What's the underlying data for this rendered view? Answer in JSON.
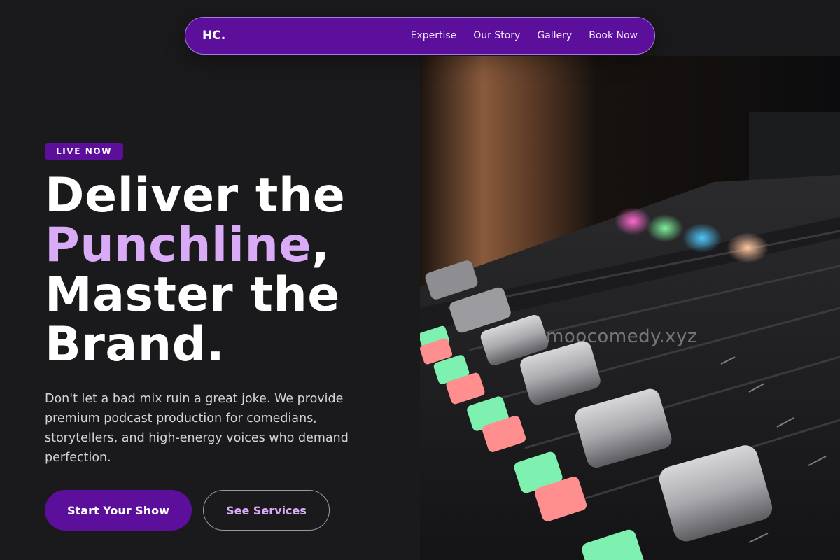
{
  "nav": {
    "logo": "HC.",
    "links": [
      {
        "label": "Expertise"
      },
      {
        "label": "Our Story"
      },
      {
        "label": "Gallery"
      },
      {
        "label": "Book Now"
      }
    ]
  },
  "hero": {
    "badge": "LIVE NOW",
    "headline": {
      "part1": "Deliver the",
      "accent": "Punchline",
      "comma": ",",
      "part2": "Master the",
      "part3": "Brand."
    },
    "lead": "Don't let a bad mix ruin a great joke. We provide premium podcast production for comedians, storytellers, and high-energy voices who demand perfection.",
    "primary_cta": "Start Your Show",
    "secondary_cta": "See Services"
  },
  "image": {
    "subject": "audio mixing console",
    "watermark": "moocomedy.xyz"
  },
  "colors": {
    "background": "#1a191b",
    "brand_purple": "#5b0f9a",
    "accent_lilac": "#d9aaf5"
  }
}
